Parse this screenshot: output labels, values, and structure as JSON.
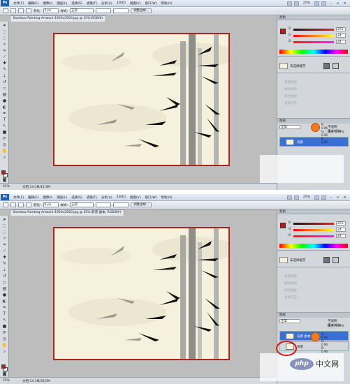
{
  "app": {
    "logo": "Ps"
  },
  "menu": [
    "文件(F)",
    "编辑(E)",
    "图像(I)",
    "图层(L)",
    "选择(S)",
    "滤镜(T)",
    "分析(A)",
    "3D(D)",
    "视图(V)",
    "窗口(W)",
    "帮助(H)"
  ],
  "menubar_right": {
    "zoom": "25%"
  },
  "options": {
    "feather_label": "羽化:",
    "feather_value": "0 px",
    "style_label": "样式:",
    "style_value": "正常",
    "refine_button": "调整边缘..."
  },
  "screens": [
    {
      "doc_tab": "Bamboo-Painting-Artwork-1920x2560.jpg @ 25%(RGB/8)",
      "status_zoom": "25%",
      "status_doc": "文档:14.1M/12.9M"
    },
    {
      "doc_tab": "Bamboo-Painting-Artwork-1920x2560.jpg @ 25%(背景 副本, RGB/8#)",
      "status_zoom": "25%",
      "status_doc": "文档:14.1M/28.0M"
    }
  ],
  "color_panel": {
    "tabs": "颜色",
    "channels": [
      {
        "label": "R",
        "value": "255"
      },
      {
        "label": "G",
        "value": "24"
      },
      {
        "label": "B",
        "value": "24"
      }
    ],
    "fg_color": "#c01717"
  },
  "navigator": {
    "name": "未选择缓存"
  },
  "actions": {
    "items": [
      "新建快照",
      "删除快照",
      "拼合图层",
      "合并可见"
    ]
  },
  "layers": {
    "tabs": "图层",
    "mode": "正常",
    "opacity_label": "不透明度:",
    "opacity_value": "100%",
    "fill_label": "填充:",
    "fill_value": "100%",
    "row_copy": "背景 副本",
    "row_bg": "背景"
  },
  "rgb_badge": {
    "line1": "R: 0.96",
    "line2": "G: 0.96",
    "line3": "B: 0.96"
  },
  "watermark": {
    "logo": "php",
    "text": "中文网"
  },
  "accent": {
    "red": "#c01717",
    "frame": "#b0221e",
    "selection": "#3b6fd6",
    "orange": "#f07b1e"
  }
}
